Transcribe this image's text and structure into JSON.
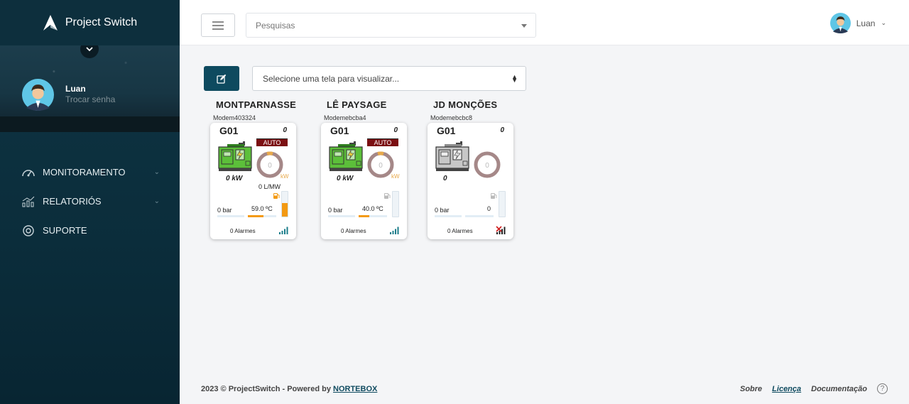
{
  "app": {
    "name": "Project Switch"
  },
  "sidebar": {
    "user_name": "Luan",
    "user_link": "Trocar senha",
    "items": [
      {
        "label": "MONITORAMENTO",
        "icon": "gauge-icon",
        "expandable": true
      },
      {
        "label": "RELATORIÓS",
        "icon": "chart-icon",
        "expandable": true
      },
      {
        "label": "SUPORTE",
        "icon": "lifebuoy-icon",
        "expandable": false
      }
    ]
  },
  "topbar": {
    "search_placeholder": "Pesquisas",
    "user_name": "Luan"
  },
  "toolbar": {
    "screen_select": "Selecione uma tela para visualizar..."
  },
  "sites": [
    {
      "title": "MONTPARNASSE",
      "modem": "Modem403324",
      "generator": "G01",
      "top_value": "0",
      "mode": "AUTO",
      "gauge_value": "0",
      "gauge_unit": "kW",
      "power": "0 kW",
      "flow": "0 L/MW",
      "pressure": "0 bar",
      "temperature": "59.0 ºC",
      "temp_level": 0.55,
      "fuel_level": 0.55,
      "alarms": "0 Alarmes",
      "online": true
    },
    {
      "title": "LÊ PAYSAGE",
      "modem": "Modemebcba4",
      "generator": "G01",
      "top_value": "0",
      "mode": "AUTO",
      "gauge_value": "0",
      "gauge_unit": "kW",
      "power": "0 kW",
      "flow": "",
      "pressure": "0 bar",
      "temperature": "40.0 ºC",
      "temp_level": 0.38,
      "fuel_level": 0.0,
      "alarms": "0 Alarmes",
      "online": true
    },
    {
      "title": "JD MONÇÕES",
      "modem": "Modemebcbc8",
      "generator": "G01",
      "top_value": "0",
      "mode": "",
      "gauge_value": "0",
      "gauge_unit": "",
      "power": "0",
      "flow": "",
      "pressure": "0 bar",
      "temperature": "0",
      "temp_level": 0.0,
      "fuel_level": 0.0,
      "alarms": "0 Alarmes",
      "online": false
    }
  ],
  "footer": {
    "copyright": "2023 © ProjectSwitch - Powered by ",
    "powered_link": "NORTEBOX",
    "links": [
      "Sobre",
      "Licença",
      "Documentação"
    ]
  },
  "colors": {
    "accent": "#0e4a5f",
    "orange": "#f39a12",
    "mode_red": "#7b0f12",
    "gen_green": "#5cbf3a"
  }
}
